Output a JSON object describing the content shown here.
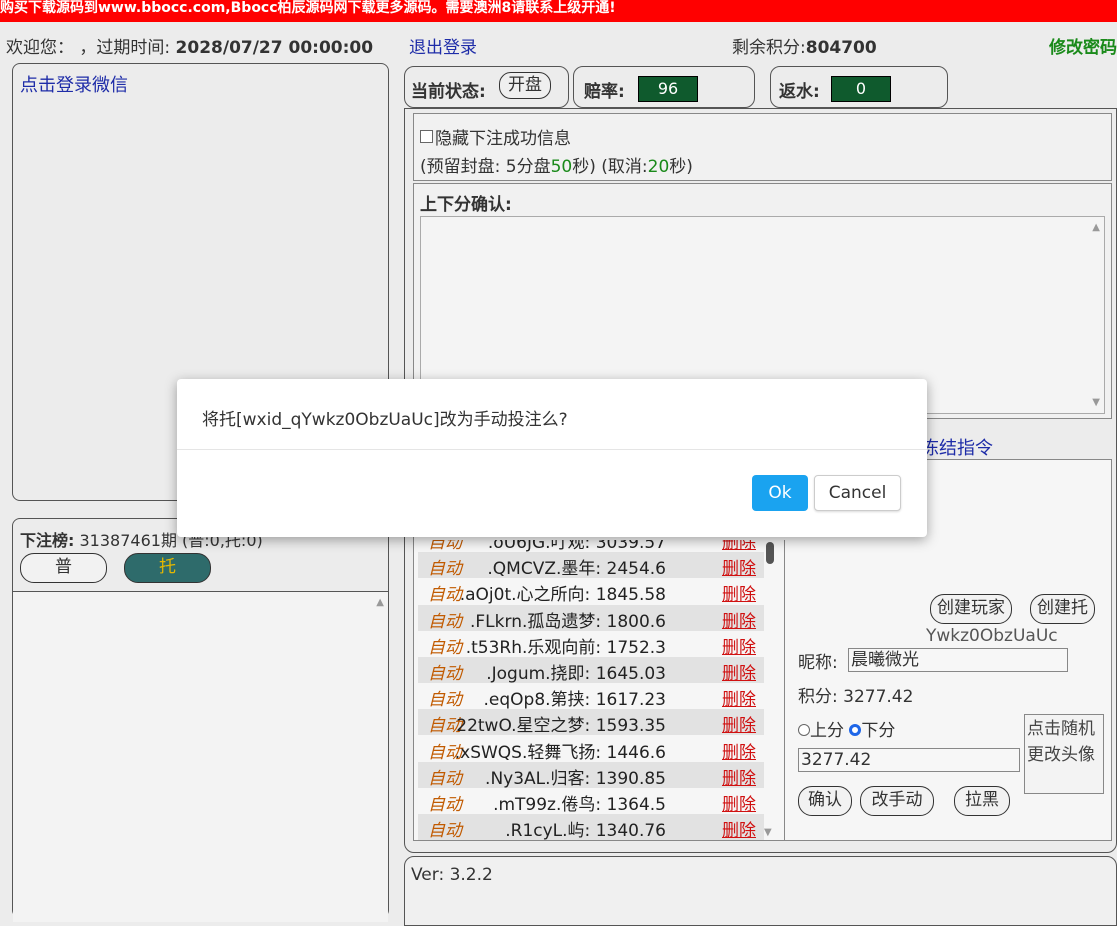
{
  "banner": "购买下载源码到www.bbocc.com,Bbocc柏辰源码网下载更多源码。需要澳洲8请联系上级开通!",
  "topbar": {
    "welcome_prefix": "欢迎您： ，过期时间: ",
    "expire_time": "2028/07/27 00:00:00",
    "logout": "退出登录",
    "points_label": "剩余积分:",
    "points_value": "804700",
    "change_password": "修改密码"
  },
  "wechat": {
    "login_link": "点击登录微信"
  },
  "betlist": {
    "title": "下注榜:",
    "issue": "31387461期 (普:0,托:0)",
    "btn_normal": "普",
    "btn_shill": "托"
  },
  "status": {
    "current_label": "当前状态:",
    "open_btn": "开盘",
    "odds_label": "赔率:",
    "odds_value": "96",
    "rebate_label": "返水:",
    "rebate_value": "0"
  },
  "options": {
    "hide_success": "隐藏下注成功信息",
    "reserve_prefix": "(预留封盘: 5分盘",
    "reserve_sec": "50",
    "reserve_mid": "秒) (取消:",
    "cancel_sec": "20",
    "reserve_suffix": "秒)"
  },
  "confirm": {
    "title": "上下分确认:"
  },
  "freeze": "冻结指令",
  "players": [
    {
      "mode": "自动",
      "name": ".oU6JG.叮观:",
      "score": "3039.57",
      "action": "删除"
    },
    {
      "mode": "自动",
      "name": ".QMCVZ.墨年:",
      "score": "2454.6",
      "action": "删除"
    },
    {
      "mode": "自动",
      "name": ".aOj0t.心之所向:",
      "score": "1845.58",
      "action": "删除"
    },
    {
      "mode": "自动",
      "name": ".FLkrn.孤岛遗梦:",
      "score": "1800.6",
      "action": "删除"
    },
    {
      "mode": "自动",
      "name": ".t53Rh.乐观向前:",
      "score": "1752.3",
      "action": "删除"
    },
    {
      "mode": "自动",
      "name": ".Jogum.挠即:",
      "score": "1645.03",
      "action": "删除"
    },
    {
      "mode": "自动",
      "name": ".eqOp8.第挟:",
      "score": "1617.23",
      "action": "删除"
    },
    {
      "mode": "自动",
      "name": "22twO.星空之梦:",
      "score": "1593.35",
      "action": "删除"
    },
    {
      "mode": "自动",
      "name": ".xSWQS.轻舞飞扬:",
      "score": "1446.6",
      "action": "删除"
    },
    {
      "mode": "自动",
      "name": ".Ny3AL.归客:",
      "score": "1390.85",
      "action": "删除"
    },
    {
      "mode": "自动",
      "name": ".mT99z.倦鸟:",
      "score": "1364.5",
      "action": "删除"
    },
    {
      "mode": "自动",
      "name": ".R1cyL.屿:",
      "score": "1340.76",
      "action": "删除"
    }
  ],
  "detail": {
    "create_player": "创建玩家",
    "create_shill": "创建托",
    "wxid_tail": "Ywkz0ObzUaUc",
    "nick_label": "昵称:",
    "nick_value": "晨曦微光",
    "score_label": "积分:",
    "score_value": "3277.42",
    "radio_up": "上分",
    "radio_down": "下分",
    "amount": "3277.42",
    "avatar_alt": "点击随机更改头像",
    "btn_confirm": "确认",
    "btn_manual": "改手动",
    "btn_block": "拉黑"
  },
  "version": "Ver: 3.2.2",
  "dialog": {
    "message": "将托[wxid_qYwkz0ObzUaUc]改为手动投注么?",
    "ok": "Ok",
    "cancel": "Cancel"
  }
}
